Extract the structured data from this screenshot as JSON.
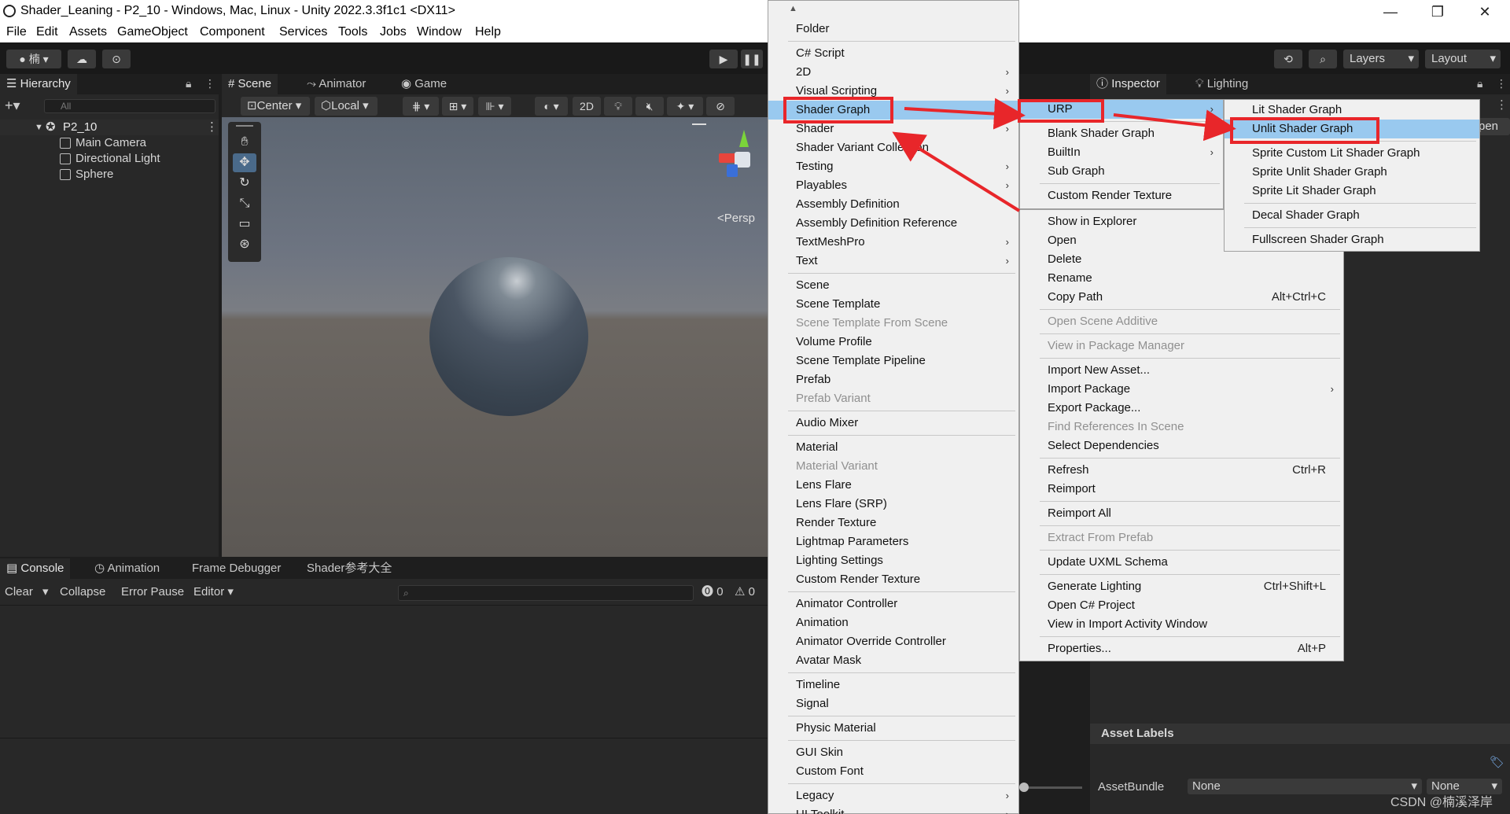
{
  "window": {
    "title": "Shader_Leaning - P2_10 - Windows, Mac, Linux - Unity 2022.3.3f1c1 <DX11>",
    "controls": {
      "minimize": "—",
      "maximize": "❐",
      "close": "✕"
    }
  },
  "menubar": [
    "File",
    "Edit",
    "Assets",
    "GameObject",
    "Component",
    "Services",
    "Tools",
    "Jobs",
    "Window",
    "Help"
  ],
  "toolbar": {
    "account_label": "楠",
    "layers_label": "Layers",
    "layout_label": "Layout"
  },
  "hierarchy": {
    "tab_label": "Hierarchy",
    "search_placeholder": "All",
    "scene_name": "P2_10",
    "objects": [
      "Main Camera",
      "Directional Light",
      "Sphere"
    ]
  },
  "scene_panel": {
    "tabs": [
      "Scene",
      "Animator",
      "Game"
    ],
    "pivot_label": "Center",
    "space_label": "Local",
    "mode_2d_label": "2D",
    "persp_label": "Persp"
  },
  "console_panel": {
    "tabs": [
      "Console",
      "Animation",
      "Frame Debugger",
      "Shader参考大全"
    ],
    "buttons": [
      "Clear",
      "Collapse",
      "Error Pause",
      "Editor"
    ],
    "warn_count": "0",
    "error_count": "0"
  },
  "inspector_panel": {
    "tabs": [
      "Inspector",
      "Lighting"
    ],
    "asset_labels_title": "Asset Labels",
    "assetbundle_label": "AssetBundle",
    "assetbundle_value": "None",
    "variant_value": "None",
    "open_fragment": "pen"
  },
  "create_menu": {
    "items": [
      {
        "label": "Folder"
      },
      {
        "sep": true
      },
      {
        "label": "C# Script"
      },
      {
        "label": "2D",
        "submenu": true
      },
      {
        "label": "Visual Scripting",
        "submenu": true
      },
      {
        "label": "Shader Graph",
        "submenu": true,
        "highlighted": true
      },
      {
        "label": "Shader",
        "submenu": true
      },
      {
        "label": "Shader Variant Collection"
      },
      {
        "label": "Testing",
        "submenu": true
      },
      {
        "label": "Playables",
        "submenu": true
      },
      {
        "label": "Assembly Definition"
      },
      {
        "label": "Assembly Definition Reference"
      },
      {
        "label": "TextMeshPro",
        "submenu": true
      },
      {
        "label": "Text",
        "submenu": true
      },
      {
        "sep": true
      },
      {
        "label": "Scene"
      },
      {
        "label": "Scene Template"
      },
      {
        "label": "Scene Template From Scene",
        "disabled": true
      },
      {
        "label": "Volume Profile"
      },
      {
        "label": "Scene Template Pipeline"
      },
      {
        "label": "Prefab"
      },
      {
        "label": "Prefab Variant",
        "disabled": true
      },
      {
        "sep": true
      },
      {
        "label": "Audio Mixer"
      },
      {
        "sep": true
      },
      {
        "label": "Material"
      },
      {
        "label": "Material Variant",
        "disabled": true
      },
      {
        "label": "Lens Flare"
      },
      {
        "label": "Lens Flare (SRP)"
      },
      {
        "label": "Render Texture"
      },
      {
        "label": "Lightmap Parameters"
      },
      {
        "label": "Lighting Settings"
      },
      {
        "label": "Custom Render Texture"
      },
      {
        "sep": true
      },
      {
        "label": "Animator Controller"
      },
      {
        "label": "Animation"
      },
      {
        "label": "Animator Override Controller"
      },
      {
        "label": "Avatar Mask"
      },
      {
        "sep": true
      },
      {
        "label": "Timeline"
      },
      {
        "label": "Signal"
      },
      {
        "sep": true
      },
      {
        "label": "Physic Material"
      },
      {
        "sep": true
      },
      {
        "label": "GUI Skin"
      },
      {
        "label": "Custom Font"
      },
      {
        "sep": true
      },
      {
        "label": "Legacy",
        "submenu": true
      },
      {
        "label": "UI Toolkit",
        "submenu": true
      }
    ]
  },
  "shadergraph_menu": {
    "items": [
      {
        "label": "URP",
        "submenu": true,
        "highlighted": true
      },
      {
        "sep": true
      },
      {
        "label": "Blank Shader Graph"
      },
      {
        "label": "BuiltIn",
        "submenu": true
      },
      {
        "label": "Sub Graph"
      },
      {
        "sep": true
      },
      {
        "label": "Custom Render Texture"
      }
    ]
  },
  "asset_context_menu": {
    "items": [
      {
        "label": "Show in Explorer"
      },
      {
        "label": "Open"
      },
      {
        "label": "Delete"
      },
      {
        "label": "Rename"
      },
      {
        "label": "Copy Path",
        "shortcut": "Alt+Ctrl+C"
      },
      {
        "sep": true
      },
      {
        "label": "Open Scene Additive",
        "disabled": true
      },
      {
        "sep": true
      },
      {
        "label": "View in Package Manager",
        "disabled": true
      },
      {
        "sep": true
      },
      {
        "label": "Import New Asset..."
      },
      {
        "label": "Import Package",
        "submenu": true
      },
      {
        "label": "Export Package..."
      },
      {
        "label": "Find References In Scene",
        "disabled": true
      },
      {
        "label": "Select Dependencies"
      },
      {
        "sep": true
      },
      {
        "label": "Refresh",
        "shortcut": "Ctrl+R"
      },
      {
        "label": "Reimport"
      },
      {
        "sep": true
      },
      {
        "label": "Reimport All"
      },
      {
        "sep": true
      },
      {
        "label": "Extract From Prefab",
        "disabled": true
      },
      {
        "sep": true
      },
      {
        "label": "Update UXML Schema"
      },
      {
        "sep": true
      },
      {
        "label": "Generate Lighting",
        "shortcut": "Ctrl+Shift+L"
      },
      {
        "label": "Open C# Project"
      },
      {
        "label": "View in Import Activity Window"
      },
      {
        "sep": true
      },
      {
        "label": "Properties...",
        "shortcut": "Alt+P"
      }
    ]
  },
  "urp_menu": {
    "items": [
      {
        "label": "Lit Shader Graph"
      },
      {
        "label": "Unlit Shader Graph",
        "highlighted": true
      },
      {
        "sep": true
      },
      {
        "label": "Sprite Custom Lit Shader Graph"
      },
      {
        "label": "Sprite Unlit Shader Graph"
      },
      {
        "label": "Sprite Lit Shader Graph"
      },
      {
        "sep": true
      },
      {
        "label": "Decal Shader Graph"
      },
      {
        "sep": true
      },
      {
        "label": "Fullscreen Shader Graph"
      }
    ]
  },
  "watermark": "CSDN @楠溪泽岸",
  "colors": {
    "highlight": "#99c9ef",
    "annotation_red": "#e8262a",
    "menu_bg": "#f0f0f0",
    "editor_dark": "#282828"
  }
}
